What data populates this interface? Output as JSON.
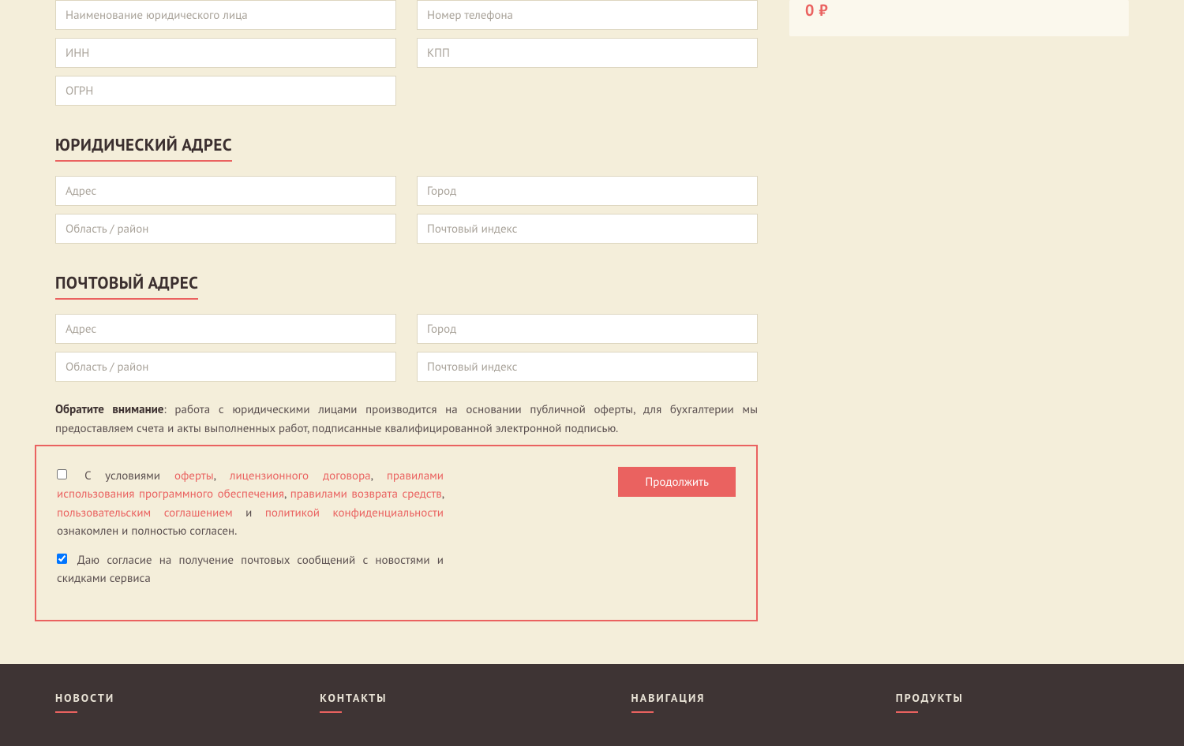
{
  "sidebar": {
    "price": "0 ₽"
  },
  "form": {
    "org_name_ph": "Наименование юридического лица",
    "phone_ph": "Номер телефона",
    "inn_ph": "ИНН",
    "kpp_ph": "КПП",
    "ogrn_ph": "ОГРН",
    "legal_title": "ЮРИДИЧЕСКИЙ АДРЕС",
    "addr_ph": "Адрес",
    "city_ph": "Город",
    "region_ph": "Область / район",
    "zip_ph": "Почтовый индекс",
    "postal_title": "ПОЧТОВЫЙ АДРЕС"
  },
  "notice": {
    "strong": "Обратите внимание",
    "text": ": работа с юридическими лицами производится на основании публичной оферты, для бухгалтерии мы предоставляем счета и акты выполненных работ, подписанные квалифицированной электронной подписью."
  },
  "consent": {
    "prefix": "С условиями ",
    "offer": "оферты",
    "c1": ", ",
    "license": "лицензионного договора",
    "c2": ", ",
    "usage": "правилами использования программного обеспечения",
    "c3": ", ",
    "refund": "правилами возврата средств",
    "c4": ", ",
    "ua": "пользовательским соглашением",
    "and": " и ",
    "privacy": "политикой конфиденциальности",
    "suffix": " ознакомлен и полностью согласен.",
    "news": "Даю согласие на получение почтовых сообщений с новостями и скидками сервиса",
    "continue": "Продолжить"
  },
  "footer": {
    "news": "НОВОСТИ",
    "contacts": "КОНТАКТЫ",
    "nav": "НАВИГАЦИЯ",
    "products": "ПРОДУКТЫ"
  }
}
